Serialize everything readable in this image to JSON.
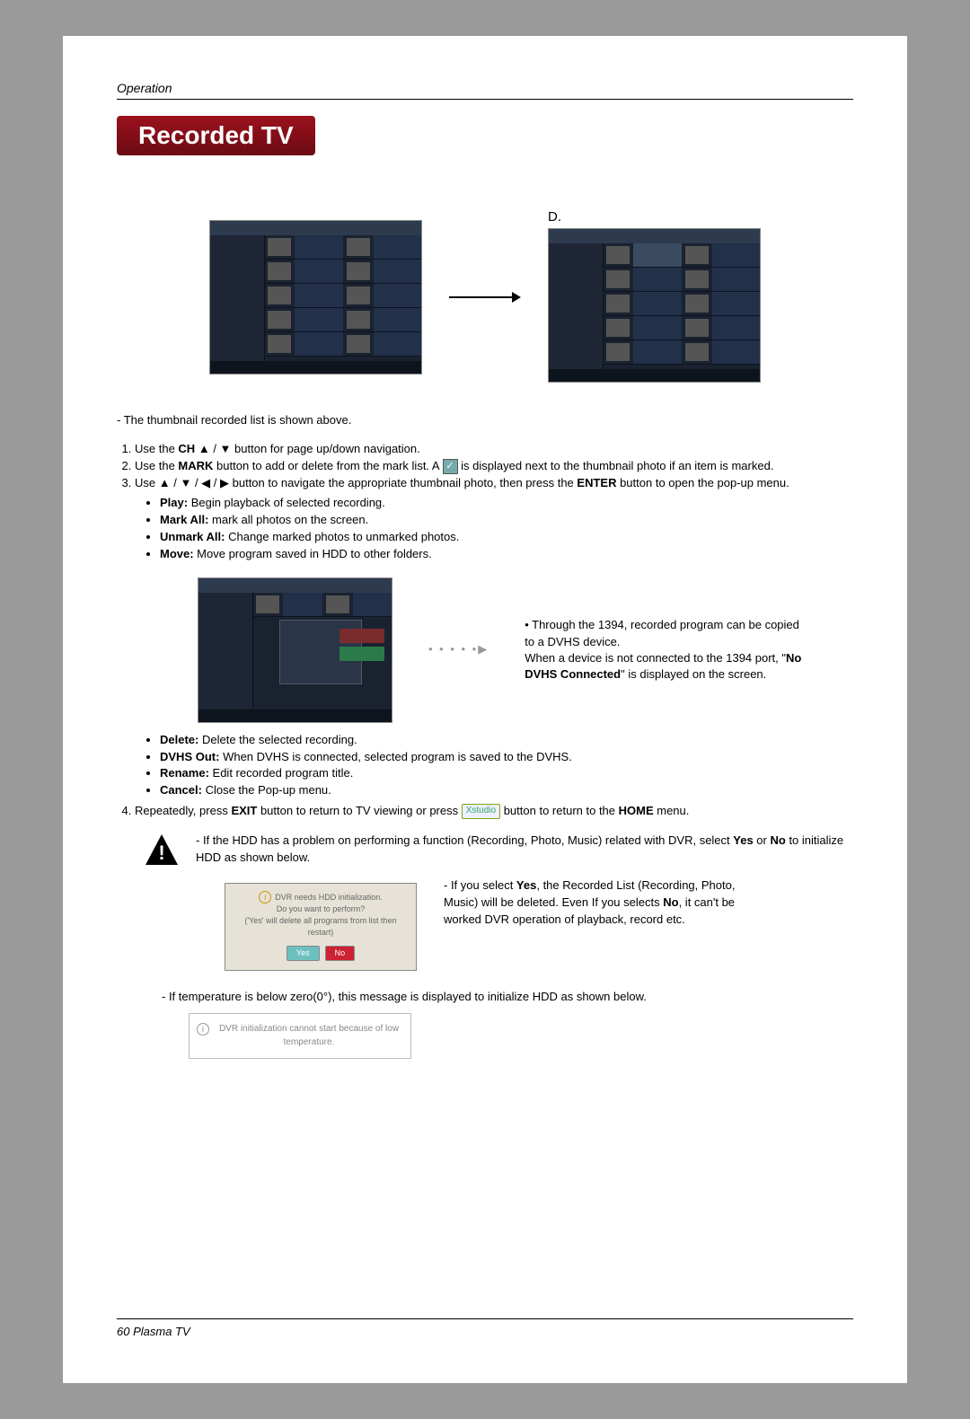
{
  "header_section": "Operation",
  "title": "Recorded TV",
  "diagram_label": "D.",
  "intro": "- The thumbnail recorded list is shown above.",
  "step1_a": "Use the ",
  "step1_b": "CH",
  "step1_c": " button for page up/down navigation.",
  "step2_a": "Use the ",
  "step2_b": "MARK",
  "step2_c": " button to add or delete from the mark list. A ",
  "step2_d": " is displayed next to the thumbnail photo if an item is marked.",
  "step3_a": "Use ",
  "step3_b": " button to navigate the appropriate thumbnail photo, then press the ",
  "step3_c": "ENTER",
  "step3_d": " button to open the pop-up menu.",
  "popup": {
    "play_b": "Play:",
    "play_t": " Begin playback of selected recording.",
    "markall_b": "Mark All:",
    "markall_t": " mark all photos on the screen.",
    "unmark_b": "Unmark All:",
    "unmark_t": " Change marked photos to unmarked photos.",
    "move_b": "Move:",
    "move_t": " Move program saved in HDD to other folders."
  },
  "side_note_a": "Through the 1394, recorded program can be copied to a DVHS device.",
  "side_note_b": "When a device is not connected to the 1394 port, \"",
  "side_note_c": "No DVHS Connected",
  "side_note_d": "\" is displayed on the screen.",
  "popup2": {
    "delete_b": "Delete:",
    "delete_t": " Delete the selected recording.",
    "dvhs_b": "DVHS Out:",
    "dvhs_t": " When DVHS is connected, selected program is saved to the DVHS.",
    "rename_b": "Rename:",
    "rename_t": " Edit recorded program title.",
    "cancel_b": "Cancel:",
    "cancel_t": " Close the Pop-up menu."
  },
  "step4_a": "Repeatedly, press ",
  "step4_b": "EXIT",
  "step4_c": " button to return to TV viewing or press ",
  "step4_d": " button to return to the ",
  "step4_e": "HOME",
  "step4_f": " menu.",
  "warn_a": "- If the HDD has a problem on performing a function (Recording, Photo, Music) related with DVR, select ",
  "warn_yes": "Yes",
  "warn_or": " or ",
  "warn_no": "No",
  "warn_b": " to initialize HDD as shown below.",
  "dialog_msg_1": "DVR needs HDD initialization.",
  "dialog_msg_2": "Do you want to perform?",
  "dialog_msg_3": "('Yes' will delete all programs from list then restart)",
  "dialog_yes": "Yes",
  "dialog_no": "No",
  "yes_note_a": "- If you select ",
  "yes_note_b": "Yes",
  "yes_note_c": ", the Recorded List (Recording, Photo, Music) will be deleted. Even If you selects ",
  "yes_note_d": "No",
  "yes_note_e": ", it can't be worked DVR operation of playback, record etc.",
  "temp_note": "- If temperature is below zero(0°), this message is displayed to initialize HDD as shown below.",
  "temp_msg": "DVR initialization cannot start because of low temperature.",
  "footer": "60   Plasma TV",
  "xhome_label": "Xstudio"
}
